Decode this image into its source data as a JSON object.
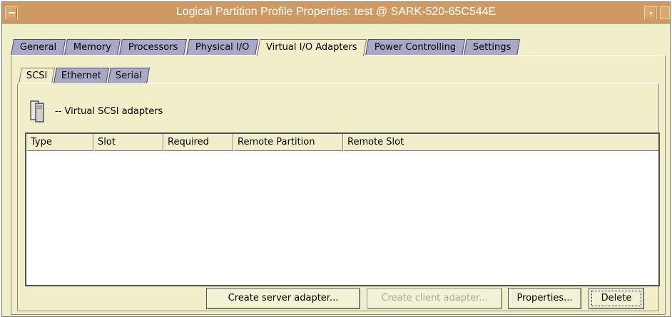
{
  "window": {
    "title": "Logical Partition Profile Properties: test @ SARK-520-65C544E"
  },
  "tabs": [
    {
      "label": "General",
      "active": false
    },
    {
      "label": "Memory",
      "active": false
    },
    {
      "label": "Processors",
      "active": false
    },
    {
      "label": "Physical I/O",
      "active": false
    },
    {
      "label": "Virtual I/O Adapters",
      "active": true
    },
    {
      "label": "Power Controlling",
      "active": false
    },
    {
      "label": "Settings",
      "active": false
    }
  ],
  "subtabs": [
    {
      "label": "SCSI",
      "active": true
    },
    {
      "label": "Ethernet",
      "active": false
    },
    {
      "label": "Serial",
      "active": false
    }
  ],
  "section": {
    "icon": "scsi-adapter-icon",
    "label": "-- Virtual SCSI adapters"
  },
  "table": {
    "columns": [
      "Type",
      "Slot",
      "Required",
      "Remote Partition",
      "Remote Slot"
    ],
    "rows": []
  },
  "buttons": {
    "create_server": "Create server adapter...",
    "create_client": "Create client adapter...",
    "properties": "Properties...",
    "delete": "Delete"
  },
  "colors": {
    "titlebar": "#cf9a62",
    "panel_bg": "#f0efc9",
    "inactive_tab": "#a9a8c9"
  }
}
